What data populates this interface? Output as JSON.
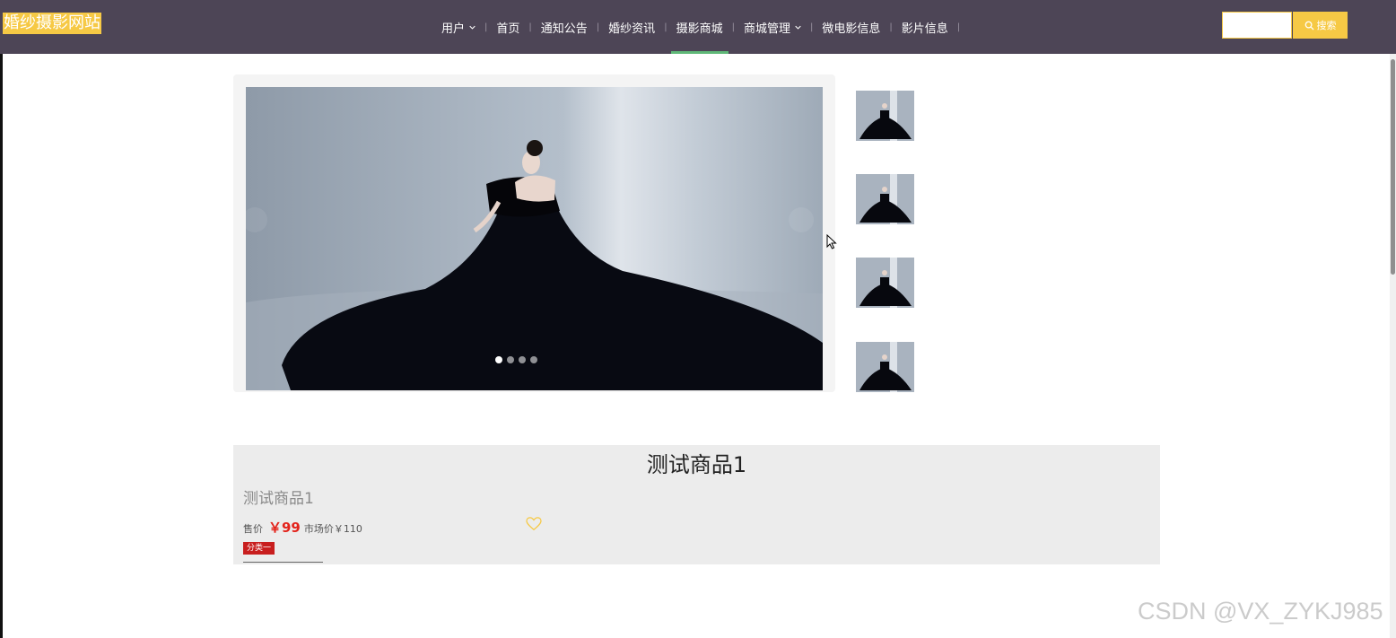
{
  "header": {
    "logo": "婚纱摄影网站",
    "nav": [
      {
        "label": "用户",
        "dropdown": true
      },
      {
        "label": "首页"
      },
      {
        "label": "通知公告"
      },
      {
        "label": "婚纱资讯"
      },
      {
        "label": "摄影商城",
        "active": true
      },
      {
        "label": "商城管理",
        "dropdown": true
      },
      {
        "label": "微电影信息"
      },
      {
        "label": "影片信息"
      }
    ],
    "search": {
      "placeholder": "",
      "button_label": "搜索"
    }
  },
  "carousel": {
    "slide_count": 4,
    "active_index": 0
  },
  "product": {
    "title": "测试商品1",
    "name": "测试商品1",
    "price_label": "售价",
    "price": "￥99",
    "market_price": "市场价￥110",
    "category_tag": "分类一"
  },
  "watermark": "CSDN @VX_ZYKJ985",
  "colors": {
    "topbar": "#4d4556",
    "accent_yellow": "#f6c945",
    "active_indicator": "#5fb878",
    "price_red": "#e3231b",
    "tag_red": "#c81e1e"
  }
}
